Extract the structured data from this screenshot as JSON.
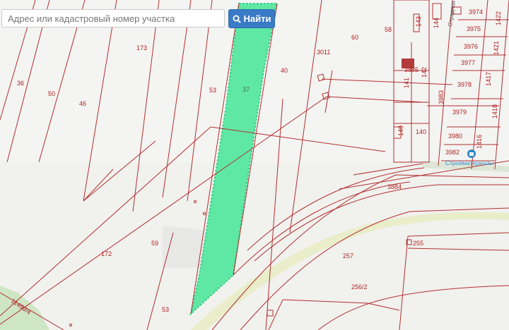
{
  "search": {
    "placeholder": "Адрес или кадастровый номер участка",
    "button_label": "Найти",
    "button_icon": "search-icon"
  },
  "map": {
    "highlight_color": "#5fe8a4",
    "boundary_color": "#b03030",
    "parcels": {
      "p173": "173",
      "p36": "36",
      "p50": "50",
      "p46": "46",
      "p53": "53",
      "p37": "37",
      "p40": "40",
      "p60": "60",
      "p58": "58",
      "p3011": "3011",
      "p143": "143",
      "p144": "144",
      "p3885": "3885",
      "p141": "141",
      "p142": "142",
      "p3983": "3983",
      "p149": "149",
      "p140": "140",
      "p3974": "3974",
      "p3975": "3975",
      "p3976": "3976",
      "p3977": "3977",
      "p3978": "3978",
      "p3979": "3979",
      "p3980": "3980",
      "p3982": "3982",
      "p1422": "1422",
      "p1421": "1421",
      "p1417": "1417",
      "p1418": "1418",
      "p1416": "1416",
      "p3884": "3884",
      "p172": "172",
      "p59": "59",
      "p53b": "53",
      "p257": "257",
      "p255": "255",
      "p2562": "256/2",
      "p11499": "11499/4"
    },
    "street": "Отрадная",
    "poi_label": "Стройматериалы"
  }
}
